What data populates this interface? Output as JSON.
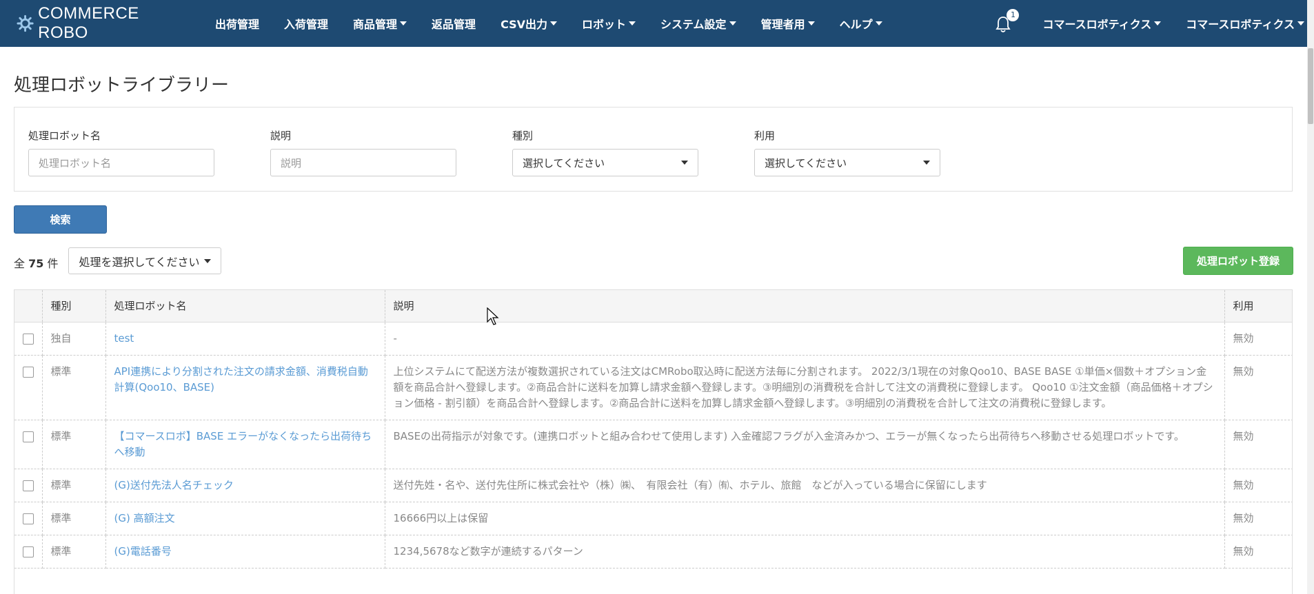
{
  "navbar": {
    "brand": "COMMERCE ROBO",
    "items": [
      {
        "label": "出荷管理",
        "caret": false
      },
      {
        "label": "入荷管理",
        "caret": false
      },
      {
        "label": "商品管理",
        "caret": true
      },
      {
        "label": "返品管理",
        "caret": false
      },
      {
        "label": "CSV出力",
        "caret": true
      },
      {
        "label": "ロボット",
        "caret": true
      },
      {
        "label": "システム設定",
        "caret": true
      },
      {
        "label": "管理者用",
        "caret": true
      },
      {
        "label": "ヘルプ",
        "caret": true
      }
    ],
    "notification_count": "1",
    "user_menu_1": "コマースロボティクス",
    "user_menu_2": "コマースロボティクス"
  },
  "page": {
    "title": "処理ロボットライブラリー"
  },
  "filters": {
    "name_label": "処理ロボット名",
    "name_placeholder": "処理ロボット名",
    "desc_label": "説明",
    "desc_placeholder": "説明",
    "type_label": "種別",
    "type_value": "選択してください",
    "usage_label": "利用",
    "usage_value": "選択してください"
  },
  "search_button": "検索",
  "summary": {
    "prefix": "全",
    "count": "75",
    "suffix": "件"
  },
  "action_select": "処理を選択してください",
  "register_button": "処理ロボット登録",
  "table": {
    "headers": [
      "種別",
      "処理ロボット名",
      "説明",
      "利用"
    ],
    "rows": [
      {
        "type": "独自",
        "name": "test",
        "desc": "-",
        "usage": "無効"
      },
      {
        "type": "標準",
        "name": "API連携により分割された注文の請求金額、消費税自動計算(Qoo10、BASE)",
        "desc": "上位システムにて配送方法が複数選択されている注文はCMRobo取込時に配送方法毎に分割されます。 2022/3/1現在の対象Qoo10、BASE BASE ①単価×個数＋オプション金額を商品合計へ登録します。②商品合計に送料を加算し請求金額へ登録します。③明細別の消費税を合計して注文の消費税に登録します。 Qoo10 ①注文金額（商品価格＋オプション価格 - 割引額）を商品合計へ登録します。②商品合計に送料を加算し請求金額へ登録します。③明細別の消費税を合計して注文の消費税に登録します。",
        "usage": "無効"
      },
      {
        "type": "標準",
        "name": "【コマースロボ】BASE エラーがなくなったら出荷待ちへ移動",
        "desc": "BASEの出荷指示が対象です。(連携ロボットと組み合わせて使用します) 入金確認フラグが入金済みかつ、エラーが無くなったら出荷待ちへ移動させる処理ロボットです。",
        "usage": "無効"
      },
      {
        "type": "標準",
        "name": "(G)送付先法人名チェック",
        "desc": "送付先姓・名や、送付先住所に株式会社や（株）㈱、　有限会社（有）㈲、ホテル、旅館　などが入っている場合に保留にします",
        "usage": "無効"
      },
      {
        "type": "標準",
        "name": "(G) 高額注文",
        "desc": "16666円以上は保留",
        "usage": "無効"
      },
      {
        "type": "標準",
        "name": "(G)電話番号",
        "desc": "1234,5678など数字が連続するパターン",
        "usage": "無効"
      }
    ]
  },
  "colors": {
    "navbar": "#1e4a72",
    "primary": "#3f7ab5",
    "success": "#5cb85c",
    "link": "#5a9bd4"
  }
}
